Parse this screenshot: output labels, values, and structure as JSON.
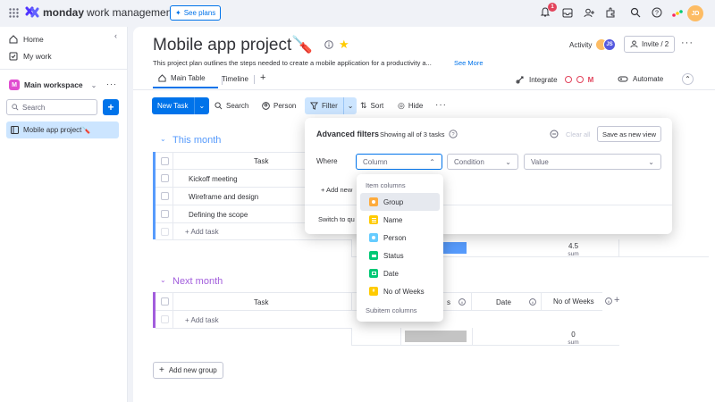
{
  "topbar": {
    "brand": "monday",
    "brand_suffix": "work management",
    "see_plans": "See plans",
    "notification_count": "1",
    "user_initials": "JD"
  },
  "sidebar": {
    "home": "Home",
    "my_work": "My work",
    "workspace_letter": "M",
    "workspace_name": "Main workspace",
    "search_placeholder": "Search",
    "board_item": "Mobile app project🪛"
  },
  "board": {
    "title": "Mobile app project🪛",
    "description": "This project plan outlines the steps needed to create a mobile application for a productivity a...",
    "see_more": "See More",
    "activity": "Activity",
    "activity_initials": "JS",
    "invite": "Invite / 2",
    "tabs": [
      "Main Table",
      "Timeline"
    ],
    "integrate": "Integrate",
    "automate": "Automate"
  },
  "toolbar": {
    "new_task": "New Task",
    "search": "Search",
    "person": "Person",
    "filter": "Filter",
    "sort": "Sort",
    "hide": "Hide"
  },
  "groups": [
    {
      "name": "This month",
      "color": "#579bfc",
      "column_task": "Task",
      "tasks": [
        "Kickoff meeting",
        "Wireframe and design",
        "Defining the scope"
      ],
      "add_task": "+ Add task",
      "sum_value": "4.5",
      "sum_label": "sum"
    },
    {
      "name": "Next month",
      "color": "#a25ddc",
      "column_task": "Task",
      "column_date": "Date",
      "column_weeks": "No of Weeks",
      "column_partial": "s",
      "add_task": "+ Add task",
      "sum_value": "0",
      "sum_label": "sum"
    }
  ],
  "add_group": "Add new group",
  "filter_popup": {
    "title": "Advanced filters",
    "subtitle": "Showing all of 3 tasks",
    "clear_all": "Clear all",
    "save_view": "Save as new view",
    "where": "Where",
    "column_placeholder": "Column",
    "condition_placeholder": "Condition",
    "value_placeholder": "Value",
    "add_new_filter": "+ Add new",
    "switch_to_quick": "Switch to qu"
  },
  "column_dropdown": {
    "section1": "Item columns",
    "items": [
      {
        "label": "Group",
        "icon": "group-icon",
        "color": "#fdab3d"
      },
      {
        "label": "Name",
        "icon": "name-icon",
        "color": "#ffcb00"
      },
      {
        "label": "Person",
        "icon": "person-icon",
        "color": "#66ccff"
      },
      {
        "label": "Status",
        "icon": "status-icon",
        "color": "#00c875"
      },
      {
        "label": "Date",
        "icon": "date-icon",
        "color": "#00c875"
      },
      {
        "label": "No of Weeks",
        "icon": "numbers-icon",
        "color": "#ffcb00"
      }
    ],
    "section2": "Subitem columns"
  },
  "colors": {
    "primary": "#0073ea",
    "selected_bg": "#cce5ff",
    "dropdown_highlight": "#e6e9ef"
  }
}
